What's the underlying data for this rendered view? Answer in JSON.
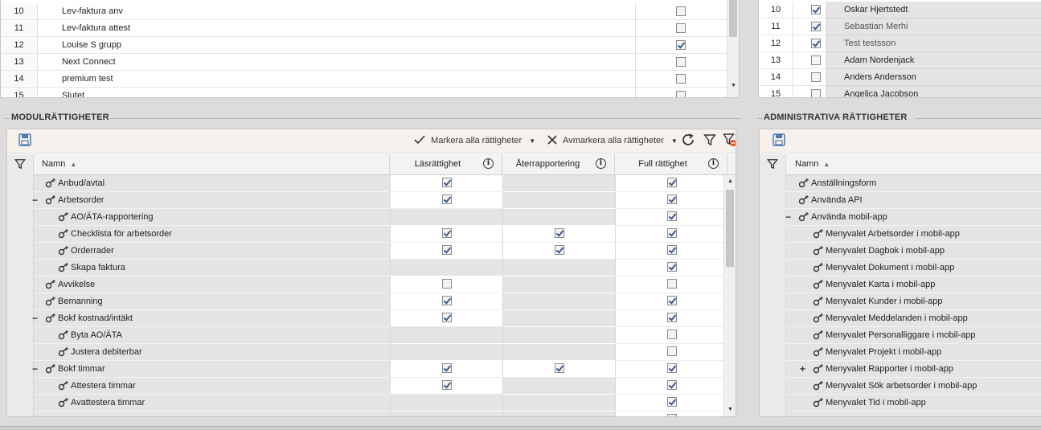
{
  "top_left": {
    "rows": [
      {
        "num": "10",
        "name": "Lev-faktura anv",
        "checked": false
      },
      {
        "num": "11",
        "name": "Lev-faktura attest",
        "checked": false
      },
      {
        "num": "12",
        "name": "Louise S grupp",
        "checked": true
      },
      {
        "num": "13",
        "name": "Next Connect",
        "checked": false
      },
      {
        "num": "14",
        "name": "premium test",
        "checked": false
      },
      {
        "num": "15",
        "name": "Slutet",
        "checked": false
      }
    ]
  },
  "top_right": {
    "rows": [
      {
        "num": "10",
        "name": "Oskar Hjertstedt",
        "checked": true,
        "grey": false
      },
      {
        "num": "11",
        "name": "Sebastian Merhi",
        "checked": true,
        "grey": true
      },
      {
        "num": "12",
        "name": "Test testsson",
        "checked": true,
        "grey": true
      },
      {
        "num": "13",
        "name": "Adam Nordenjack",
        "checked": false,
        "grey": false
      },
      {
        "num": "14",
        "name": "Anders Andersson",
        "checked": false,
        "grey": false
      },
      {
        "num": "15",
        "name": "Angelica Jacobson",
        "checked": false,
        "grey": false
      }
    ]
  },
  "modul": {
    "title": "MODULRÄTTIGHETER",
    "toolbar": {
      "mark_all": "Markera alla rättigheter",
      "unmark_all": "Avmarkera alla rättigheter"
    },
    "columns": {
      "name": "Namn",
      "read": "Läsrättighet",
      "report": "Återrapportering",
      "full": "Full rättighet"
    },
    "rows": [
      {
        "name": "Anbud/avtal",
        "level": 0,
        "toggle": "",
        "read": "unchecked-on",
        "report": "disabled",
        "full": "on"
      },
      {
        "name": "Arbetsorder",
        "level": 0,
        "toggle": "−",
        "read": "on",
        "report": "disabled",
        "full": "on"
      },
      {
        "name": "AO/ÄTA-rapportering",
        "level": 1,
        "toggle": "",
        "read": "disabled",
        "report": "disabled",
        "full": "on"
      },
      {
        "name": "Checklista för arbetsorder",
        "level": 1,
        "toggle": "",
        "read": "on",
        "report": "on",
        "full": "on"
      },
      {
        "name": "Orderrader",
        "level": 1,
        "toggle": "",
        "read": "on",
        "report": "on",
        "full": "on"
      },
      {
        "name": "Skapa faktura",
        "level": 1,
        "toggle": "",
        "read": "disabled",
        "report": "disabled",
        "full": "on"
      },
      {
        "name": "Avvikelse",
        "level": 0,
        "toggle": "",
        "read": "off",
        "report": "disabled",
        "full": "off"
      },
      {
        "name": "Bemanning",
        "level": 0,
        "toggle": "",
        "read": "on",
        "report": "disabled",
        "full": "on"
      },
      {
        "name": "Bokf kostnad/intäkt",
        "level": 0,
        "toggle": "−",
        "read": "on",
        "report": "disabled",
        "full": "on"
      },
      {
        "name": "Byta AO/ÄTA",
        "level": 1,
        "toggle": "",
        "read": "disabled",
        "report": "disabled",
        "full": "off"
      },
      {
        "name": "Justera debiterbar",
        "level": 1,
        "toggle": "",
        "read": "disabled",
        "report": "disabled",
        "full": "off"
      },
      {
        "name": "Bokf timmar",
        "level": 0,
        "toggle": "−",
        "read": "on",
        "report": "on",
        "full": "on"
      },
      {
        "name": "Attestera timmar",
        "level": 1,
        "toggle": "",
        "read": "on",
        "report": "disabled",
        "full": "on"
      },
      {
        "name": "Avattestera timmar",
        "level": 1,
        "toggle": "",
        "read": "disabled",
        "report": "disabled",
        "full": "on"
      },
      {
        "name": "",
        "level": 1,
        "toggle": "",
        "read": "disabled",
        "report": "disabled",
        "full": "on"
      }
    ]
  },
  "admin": {
    "title": "ADMINISTRATIVA RÄTTIGHETER",
    "columns": {
      "name": "Namn"
    },
    "rows": [
      {
        "name": "Anställningsform",
        "level": 0,
        "toggle": ""
      },
      {
        "name": "Använda API",
        "level": 0,
        "toggle": ""
      },
      {
        "name": "Använda mobil-app",
        "level": 0,
        "toggle": "−"
      },
      {
        "name": "Menyvalet Arbetsorder i mobil-app",
        "level": 1,
        "toggle": ""
      },
      {
        "name": "Menyvalet Dagbok i mobil-app",
        "level": 1,
        "toggle": ""
      },
      {
        "name": "Menyvalet Dokument i mobil-app",
        "level": 1,
        "toggle": ""
      },
      {
        "name": "Menyvalet Karta i mobil-app",
        "level": 1,
        "toggle": ""
      },
      {
        "name": "Menyvalet Kunder i mobil-app",
        "level": 1,
        "toggle": ""
      },
      {
        "name": "Menyvalet Meddelanden i mobil-app",
        "level": 1,
        "toggle": ""
      },
      {
        "name": "Menyvalet Personalliggare i mobil-app",
        "level": 1,
        "toggle": ""
      },
      {
        "name": "Menyvalet Projekt i mobil-app",
        "level": 1,
        "toggle": ""
      },
      {
        "name": "Menyvalet Rapporter i mobil-app",
        "level": 1,
        "toggle": "+"
      },
      {
        "name": "Menyvalet Sök arbetsorder i mobil-app",
        "level": 1,
        "toggle": ""
      },
      {
        "name": "Menyvalet Tid i mobil-app",
        "level": 1,
        "toggle": ""
      },
      {
        "name": "",
        "level": 1,
        "toggle": ""
      }
    ]
  },
  "icons": {
    "save": "save-icon",
    "check": "check-icon",
    "close": "close-icon",
    "refresh": "refresh-icon",
    "filter": "filter-icon",
    "filter_clear": "filter-clear-icon",
    "key": "key-icon",
    "info": "info-icon",
    "sort": "sort-asc-icon"
  },
  "colors": {
    "accent": "#3a5a8c",
    "filter_clear": "#e8531f",
    "disabled_cell": "#e4e4e4"
  }
}
